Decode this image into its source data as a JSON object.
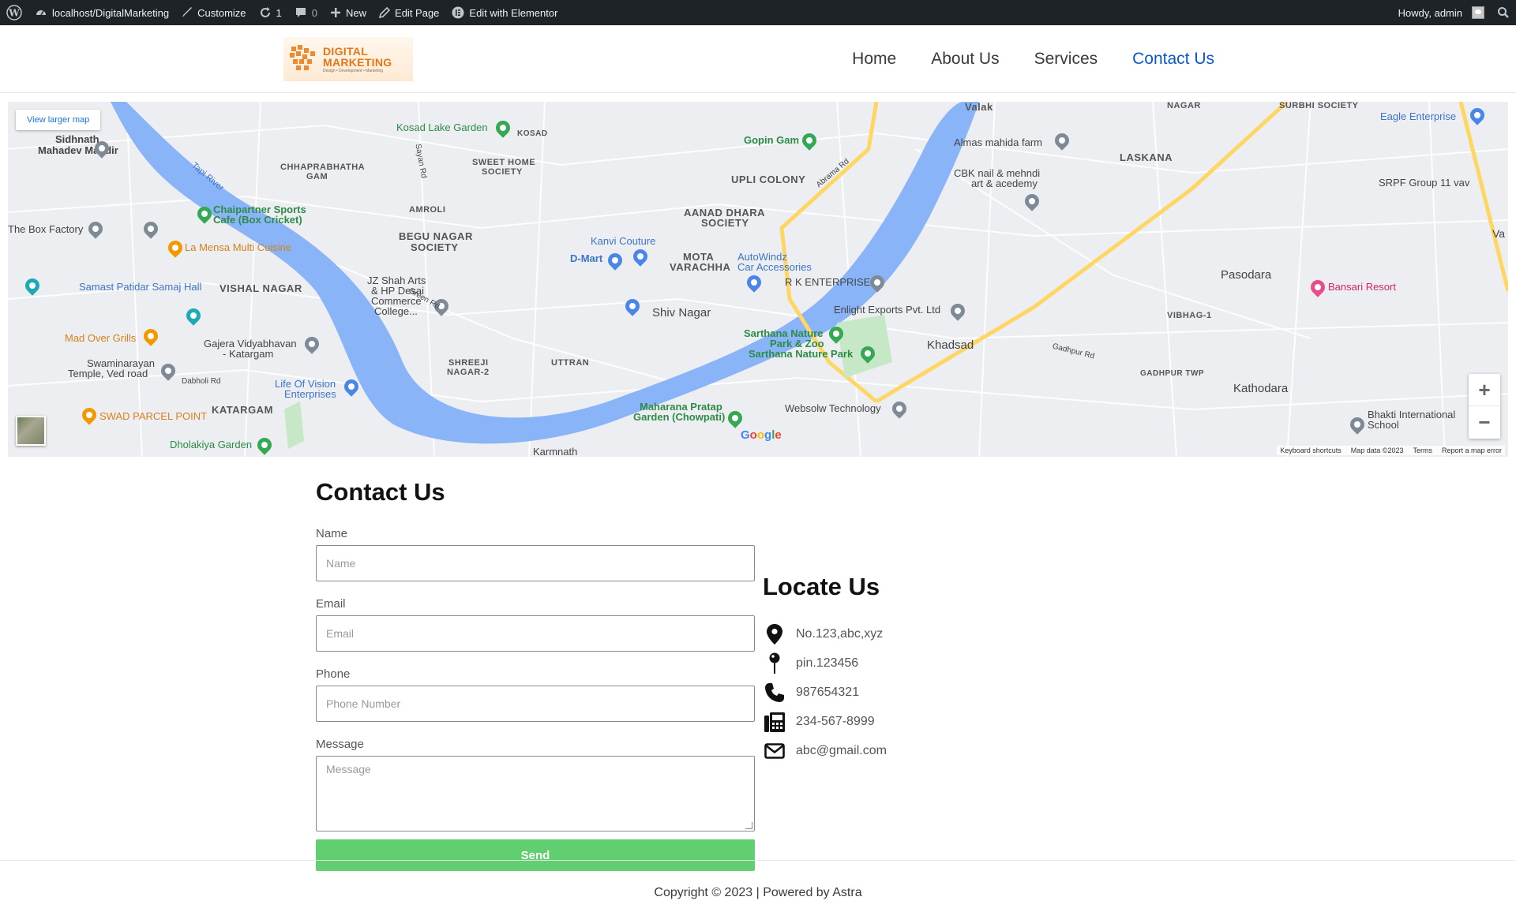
{
  "admin_bar": {
    "site": "localhost/DigitalMarketing",
    "customize": "Customize",
    "updates_count": "1",
    "comments_count": "0",
    "new": "New",
    "edit_page": "Edit Page",
    "edit_elementor": "Edit with Elementor",
    "howdy": "Howdy, admin"
  },
  "header": {
    "logo": {
      "line1": "DIGITAL",
      "line2": "MARKETING",
      "tagline": "Design • Development • Marketing"
    },
    "nav": [
      {
        "label": "Home",
        "active": false
      },
      {
        "label": "About Us",
        "active": false
      },
      {
        "label": "Services",
        "active": false
      },
      {
        "label": "Contact Us",
        "active": true
      }
    ]
  },
  "map": {
    "larger_map": "View larger map",
    "labels": {
      "sidhnath": "Sidhnath",
      "mahadev": "Mahadev Mandir",
      "kosad_lake": "Kosad Lake Garden",
      "kosad": "KOSAD",
      "chhaprabhatha": "CHHAPRABHATHA",
      "gam": "GAM",
      "sweet_home": "SWEET HOME",
      "society": "SOCIETY",
      "tapi_river": "Tapi River",
      "chaipartner": "Chaipartner Sports",
      "cafe": "Cafe (Box Cricket)",
      "box_factory": "The Box Factory",
      "la_mensa": "La Mensa Multi Cuisine",
      "amroli": "AMROLI",
      "begu_nagar": "BEGU NAGAR",
      "begu_society": "SOCIETY",
      "samast": "Samast Patidar Samaj Hall",
      "vishal_nagar": "VISHAL NAGAR",
      "jz_shah": "JZ Shah Arts",
      "hp_desai": "& HP Desai",
      "commerce": "Commerce",
      "college": "College...",
      "mad_over": "Mad Over Grills",
      "gajera": "Gajera Vidyabhavan",
      "katargam_sub": "- Katargam",
      "swaminarayan": "Swaminarayan",
      "temple_ved": "Temple, Ved road",
      "dabholi": "Dabholi Rd",
      "shreeji": "SHREEJI",
      "nagar2": "NAGAR-2",
      "uttran": "UTTRAN",
      "life_vision": "Life Of Vision",
      "enterprises": "Enterprises",
      "swad": "SWAD PARCEL POINT",
      "katargam": "KATARGAM",
      "dholakiya": "Dholakiya Garden",
      "karmnath": "Karmnath",
      "upli_colony": "UPLI COLONY",
      "gopin_gam": "Gopin Gam",
      "aanad": "AANAD DHARA",
      "aanad_soc": "SOCIETY",
      "kanvi": "Kanvi Couture",
      "dmart": "D-Mart",
      "mota": "MOTA",
      "varachha": "VARACHHA",
      "autowindz": "AutoWindz",
      "car_acc": "Car Accessories",
      "rk_ent": "R K ENTERPRISE",
      "shiv_nagar": "Shiv Nagar",
      "enlight": "Enlight Exports Pvt. Ltd",
      "sarthana1": "Sarthana Nature",
      "sarthana2": "Park & Zoo",
      "sarthana3": "Sarthana Nature Park",
      "khadsad": "Khadsad",
      "maharana": "Maharana Pratap",
      "garden": "Garden (Chowpati)",
      "websolw": "Websolw Technology",
      "valak": "Valak",
      "almas": "Almas mahida farm",
      "cbk": "CBK nail & mehndi",
      "art_acad": "art & acedemy",
      "laskana": "LASKANA",
      "surbhi": "SURBHI SOCIETY",
      "eagle": "Eagle Enterprise",
      "srpf": "SRPF Group 11 vav",
      "pasodara": "Pasodara",
      "bansari": "Bansari Resort",
      "vibhag": "VIBHAG-1",
      "gadhpur": "GADHPUR TWP",
      "kathodara": "Kathodara",
      "bhakti": "Bhakti International",
      "school": "School",
      "abrama": "Abrama Rd",
      "gadhpur_rd": "Gadhpur Rd",
      "green_rd": "Green Rd",
      "sayan_rd": "Sayan Rd",
      "nagar_top": "NAGAR",
      "va": "Va"
    },
    "google": "Google",
    "footer": [
      "Keyboard shortcuts",
      "Map data ©2023",
      "Terms",
      "Report a map error"
    ]
  },
  "contact": {
    "title": "Contact Us",
    "fields": {
      "name_label": "Name",
      "name_placeholder": "Name",
      "email_label": "Email",
      "email_placeholder": "Email",
      "phone_label": "Phone",
      "phone_placeholder": "Phone Number",
      "message_label": "Message",
      "message_placeholder": "Message"
    },
    "send": "Send"
  },
  "locate": {
    "title": "Locate Us",
    "items": [
      {
        "icon": "map-marker-icon",
        "text": "No.123,abc,xyz"
      },
      {
        "icon": "pin-icon",
        "text": "pin.123456"
      },
      {
        "icon": "phone-icon",
        "text": "987654321"
      },
      {
        "icon": "fax-icon",
        "text": "234-567-8999"
      },
      {
        "icon": "envelope-icon",
        "text": "abc@gmail.com"
      }
    ]
  },
  "footer": {
    "text": "Copyright © 2023 | Powered by Astra"
  },
  "colors": {
    "admin_bar": "#1d2327",
    "nav_active": "#0a58ca",
    "send_button": "#61ce70",
    "river": "#8ab4f8"
  }
}
